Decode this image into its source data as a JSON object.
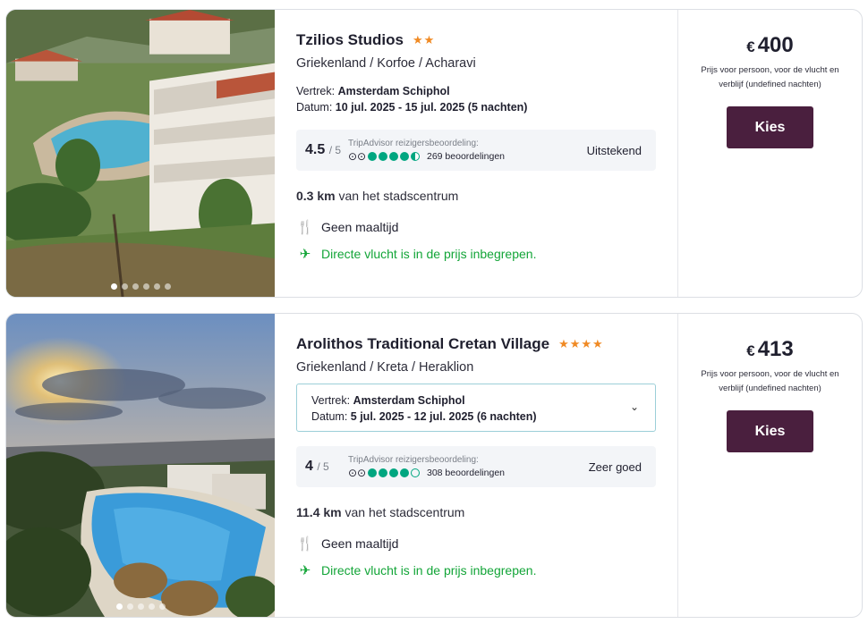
{
  "results": [
    {
      "name": "Tzilios Studios",
      "stars": "★★",
      "location": "Griekenland / Korfoe / Acharavi",
      "depart_label": "Vertrek:",
      "depart_value": "Amsterdam Schiphol",
      "date_label": "Datum:",
      "date_value": "10 jul. 2025 - 15 jul. 2025 (5 nachten)",
      "rating": "4.5",
      "rating_max": "/ 5",
      "ta_label": "TripAdvisor reizigersbeoordeling:",
      "bubbles": 4.5,
      "review_count": "269 beoordelingen",
      "rating_word": "Uitstekend",
      "distance_value": "0.3 km",
      "distance_text": "van het stadscentrum",
      "meal": "Geen maaltijd",
      "flight": "Directe vlucht is in de prijs inbegrepen.",
      "currency": "€",
      "price": "400",
      "price_note": "Prijs voor persoon, voor de vlucht en verblijf (undefined nachten)",
      "button": "Kies",
      "photo_dots": 6,
      "active_dot": 0
    },
    {
      "name": "Arolithos Traditional Cretan Village",
      "stars": "★★★★",
      "location": "Griekenland / Kreta / Heraklion",
      "depart_label": "Vertrek:",
      "depart_value": "Amsterdam Schiphol",
      "date_label": "Datum:",
      "date_value": "5 jul. 2025 - 12 jul. 2025 (6 nachten)",
      "rating": "4",
      "rating_max": "/ 5",
      "ta_label": "TripAdvisor reizigersbeoordeling:",
      "bubbles": 4,
      "review_count": "308 beoordelingen",
      "rating_word": "Zeer goed",
      "distance_value": "11.4 km",
      "distance_text": "van het stadscentrum",
      "meal": "Geen maaltijd",
      "flight": "Directe vlucht is in de prijs inbegrepen.",
      "currency": "€",
      "price": "413",
      "price_note": "Prijs voor persoon, voor de vlucht en verblijf (undefined nachten)",
      "button": "Kies",
      "photo_dots": 5,
      "active_dot": 0
    }
  ],
  "colors": {
    "button_bg": "#4a1f3e",
    "flight_green": "#13a538",
    "tripadvisor_green": "#00a680",
    "star_orange": "#f08a24"
  }
}
